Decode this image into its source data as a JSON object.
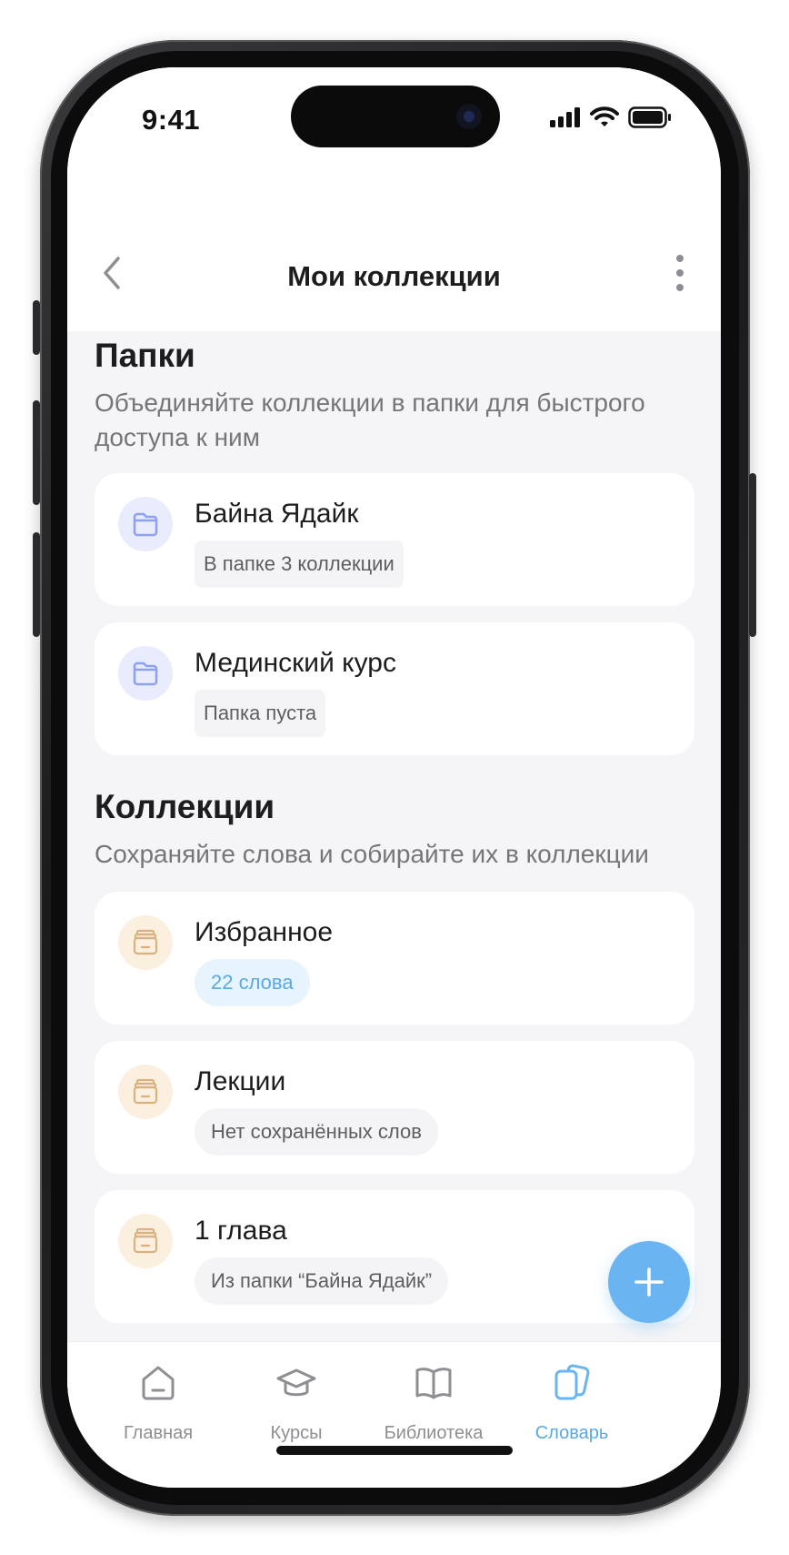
{
  "status_bar": {
    "time": "9:41"
  },
  "nav": {
    "title": "Мои коллекции"
  },
  "folders_section": {
    "title": "Папки",
    "subtitle": "Объединяйте коллекции в папки для быстрого доступа к ним",
    "items": [
      {
        "title": "Байна Ядайк",
        "meta": "В папке 3 коллекции"
      },
      {
        "title": "Мединский курс",
        "meta": "Папка пуста"
      }
    ]
  },
  "collections_section": {
    "title": "Коллекции",
    "subtitle": "Сохраняйте слова и собирайте их в коллекции",
    "items": [
      {
        "title": "Избранное",
        "meta": "22 слова"
      },
      {
        "title": "Лекции",
        "meta": "Нет сохранённых слов"
      },
      {
        "title": "1 глава",
        "meta": "Из папки “Байна Ядайк”"
      }
    ]
  },
  "tabs": [
    {
      "label": "Главная",
      "icon": "home-icon",
      "active": false
    },
    {
      "label": "Курсы",
      "icon": "graduation-cap-icon",
      "active": false
    },
    {
      "label": "Библиотека",
      "icon": "book-icon",
      "active": false
    },
    {
      "label": "Словарь",
      "icon": "cards-icon",
      "active": true
    }
  ],
  "colors": {
    "accent": "#6ab4f1",
    "accent_text": "#5aa8e6",
    "folder_icon_bg": "#e8ecfd",
    "folder_icon": "#8ea0f0",
    "collection_icon_bg": "#fbefe0",
    "collection_icon": "#d9b27e",
    "screen_bg": "#f5f5f7"
  }
}
